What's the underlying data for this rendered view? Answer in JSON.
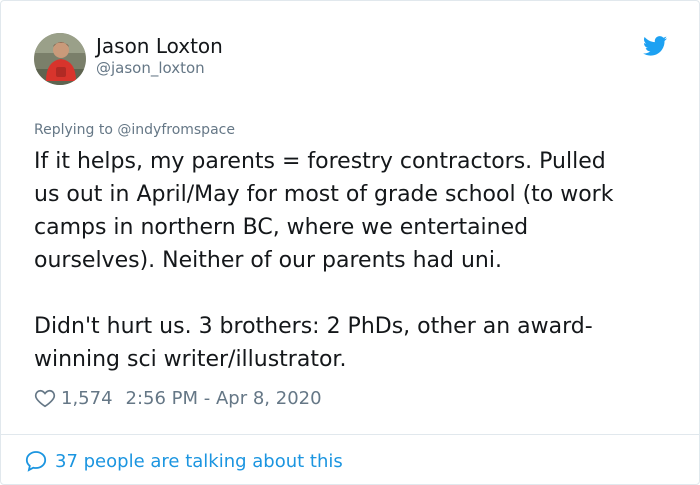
{
  "author": {
    "name": "Jason Loxton",
    "handle": "@jason_loxton"
  },
  "reply_context": "Replying to @indyfromspace",
  "tweet_lines": [
    "If it helps, my parents = forestry contractors. Pulled",
    "us out in April/May for most of grade school (to work",
    "camps in northern BC, where we entertained",
    "ourselves). Neither of our parents had uni.",
    "",
    "Didn't hurt us. 3 brothers: 2 PhDs, other an award-",
    "winning sci writer/illustrator."
  ],
  "likes": "1,574",
  "timestamp": "2:56 PM - Apr 8, 2020",
  "conversation": "37 people are talking about this",
  "colors": {
    "accent": "#1da1f2",
    "link": "#1b95e0",
    "muted": "#657786",
    "text": "#14171a",
    "border": "#e1e8ed"
  },
  "icons": [
    "avatar",
    "twitter-bird-icon",
    "heart-icon",
    "speech-bubble-icon"
  ]
}
